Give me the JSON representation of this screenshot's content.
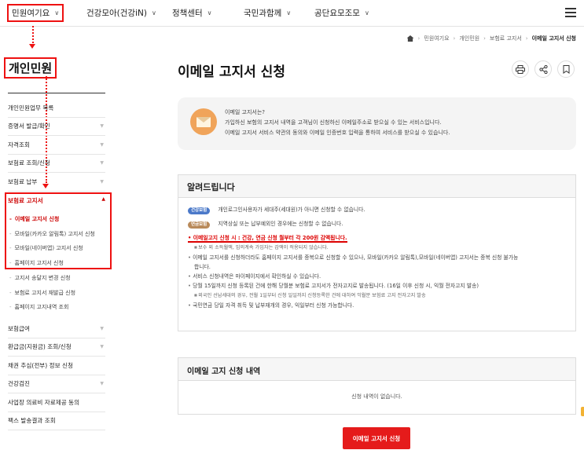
{
  "nav": {
    "items": [
      {
        "label": "민원여기요",
        "active": true
      },
      {
        "label": "건강모아(건강iN)",
        "active": false
      },
      {
        "label": "정책센터",
        "active": false
      },
      {
        "label": "국민과함께",
        "active": false
      },
      {
        "label": "공단요모조모",
        "active": false
      }
    ]
  },
  "breadcrumb": {
    "items": [
      "민원여기요",
      "개인민원",
      "보험료 고지서"
    ],
    "current": "이메일 고지서 신청"
  },
  "sidebar": {
    "title": "개인민원",
    "items_top": [
      {
        "label": "개인민원업무 목록",
        "expandable": false
      },
      {
        "label": "증명서 발급/확인",
        "expandable": true
      },
      {
        "label": "자격조회",
        "expandable": true
      },
      {
        "label": "보험료 조회/신청",
        "expandable": true
      },
      {
        "label": "보험료 납부",
        "expandable": true
      }
    ],
    "open_section": "보험료 고지서",
    "sub_items": [
      {
        "label": "이메일 고지서 신청",
        "active": true
      },
      {
        "label": "모바일(카카오 알림톡) 고지서 신청",
        "active": false
      },
      {
        "label": "모바일(네이버앱) 고지서 신청",
        "active": false
      },
      {
        "label": "홈페이지 고지서 신청",
        "active": false
      }
    ],
    "sub_items_2": [
      {
        "label": "고지서 송달지 변경 신청"
      },
      {
        "label": "보험료 고지서 재발급 신청"
      },
      {
        "label": "홈페이지 고지내역 조회"
      }
    ],
    "items_bottom": [
      {
        "label": "보험급여",
        "expandable": true
      },
      {
        "label": "환급금(지원금) 조회/신청",
        "expandable": true
      },
      {
        "label": "채권 추심(전부) 정보 신청",
        "expandable": false
      },
      {
        "label": "건강검진",
        "expandable": true
      },
      {
        "label": "사업장 의료비 자료제공 동의",
        "expandable": false
      },
      {
        "label": "팩스 발송결과 조회",
        "expandable": false
      }
    ]
  },
  "main": {
    "title": "이메일 고지서 신청",
    "info": {
      "q": "이메일 고지서는?",
      "line1": "가입하신 보험의 고지서 내역을 고객님이 신청하신 이메일주소로 받으실 수 있는 서비스입니다.",
      "line2": "이메일 고지서 서비스 약관의 동의와 이메일 인증번호 입력을 통하여 서비스를 받으실 수 있습니다."
    },
    "notice": {
      "title": "알려드립니다",
      "badge1": "건강보험",
      "row1": "개인로그인사용자가 세대주(세대원)가 아니면 신청할 수 없습니다.",
      "badge2": "연금보험",
      "row2": "지역상실 또는 납부예외인 경우에는 신청할 수 없습니다.",
      "red": "이메일고지 신청 시 : 건강, 연금 신청 월부터 각 200원 감액됩니다.",
      "red_sub": "보수 외 소득월액, 임의계속 가입자는 감액이 적용되지 않습니다.",
      "b1a": "이메일 고지서를 신청하더라도 홈페이지 고지서를 중복으로 신청할 수 있으나, 모바일(카카오 알림톡),모바일(네이버앱) 고지서는 중복 신청 불가능",
      "b1b": "합니다.",
      "b2": "서비스 신청내역은 마이페이지에서 확인하실 수 있습니다.",
      "b3": "당월 15일까지 신청 등록된 건에 한해 당월분 보험료 고지서가 전자고지로 발송됩니다. (16일 이후 신청 시, 익월 전자고지 발송)",
      "b3_sub": "외국인 선납세대의 경우, 전월 1일부터 신청 일일까지 신청등록한 건에 대하여 익월분 보험료 고지 전자고지 발송",
      "b4": "국민연금 당일 자격 취득 및 납부재개의 경우, 익일부터 신청 가능합니다."
    },
    "history": {
      "title": "이메일 고지 신청 내역",
      "empty": "신청 내역이 없습니다."
    },
    "apply_button": "이메일 고지서 신청"
  },
  "colors": {
    "accent": "#e51b1b",
    "info_icon": "#f0a45a"
  }
}
